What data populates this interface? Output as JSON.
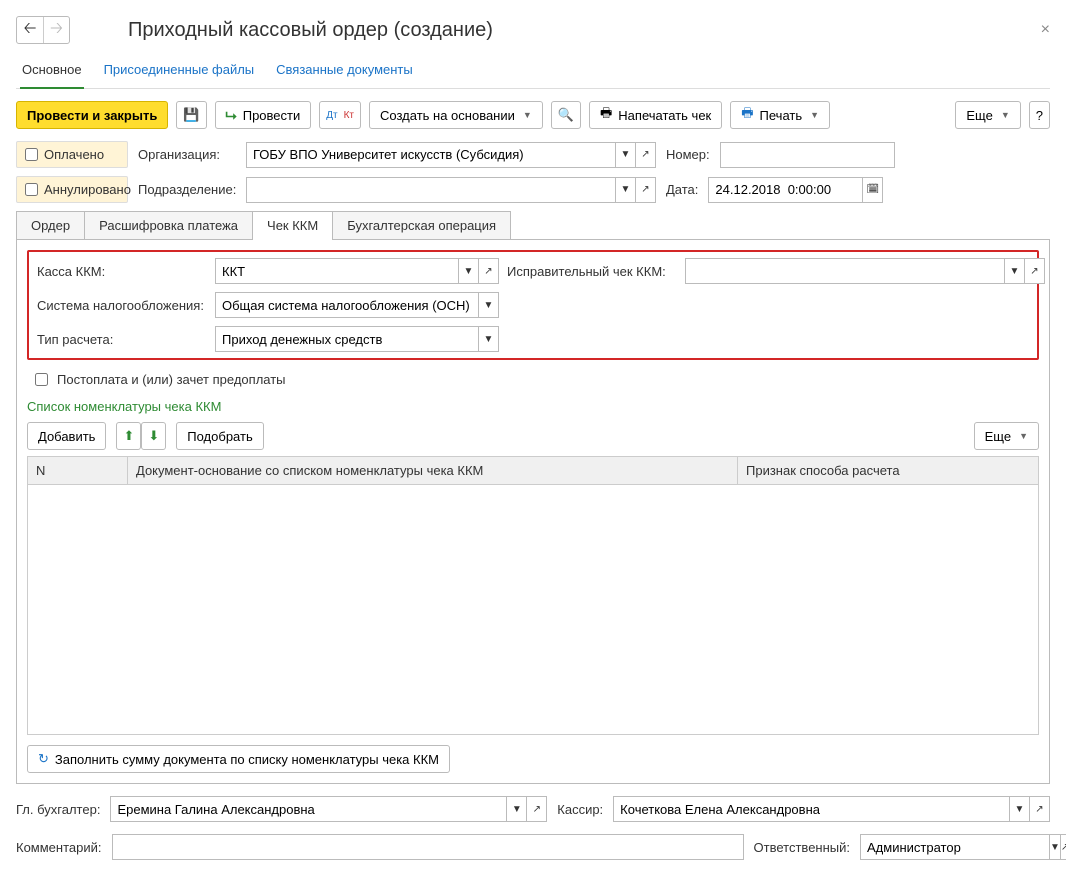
{
  "title": "Приходный кассовый ордер (создание)",
  "subtabs": {
    "main": "Основное",
    "files": "Присоединенные файлы",
    "linked": "Связанные документы"
  },
  "toolbar": {
    "post_close": "Провести и закрыть",
    "post": "Провести",
    "create_based": "Создать на основании",
    "print_cheque": "Напечатать чек",
    "print": "Печать",
    "more": "Еще",
    "help": "?"
  },
  "fields": {
    "paid": "Оплачено",
    "annulled": "Аннулировано",
    "org_label": "Организация:",
    "org_value": "ГОБУ ВПО Университет искусств (Субсидия)",
    "dept_label": "Подразделение:",
    "dept_value": "",
    "number_label": "Номер:",
    "number_value": "",
    "date_label": "Дата:",
    "date_value": "24.12.2018  0:00:00"
  },
  "tabs": {
    "order": "Ордер",
    "detail": "Расшифровка платежа",
    "cheque": "Чек ККМ",
    "acc": "Бухгалтерская операция"
  },
  "kkm": {
    "kassa_label": "Касса ККМ:",
    "kassa_value": "ККТ",
    "corr_label": "Исправительный чек ККМ:",
    "corr_value": "",
    "tax_label": "Система налогообложения:",
    "tax_value": "Общая система налогообложения (ОСН)",
    "calc_label": "Тип расчета:",
    "calc_value": "Приход денежных средств",
    "postpay": "Постоплата и (или) зачет предоплаты",
    "list_title": "Список номенклатуры чека ККМ",
    "add": "Добавить",
    "pick": "Подобрать",
    "more": "Еще",
    "col_n": "N",
    "col_doc": "Документ-основание со списком номенклатуры чека ККМ",
    "col_method": "Признак способа расчета",
    "fill_btn": "Заполнить сумму документа по списку номенклатуры чека ККМ"
  },
  "footer": {
    "chief_label": "Гл. бухгалтер:",
    "chief_value": "Еремина Галина Александровна",
    "cashier_label": "Кассир:",
    "cashier_value": "Кочеткова Елена Александровна",
    "comment_label": "Комментарий:",
    "comment_value": "",
    "resp_label": "Ответственный:",
    "resp_value": "Администратор"
  }
}
